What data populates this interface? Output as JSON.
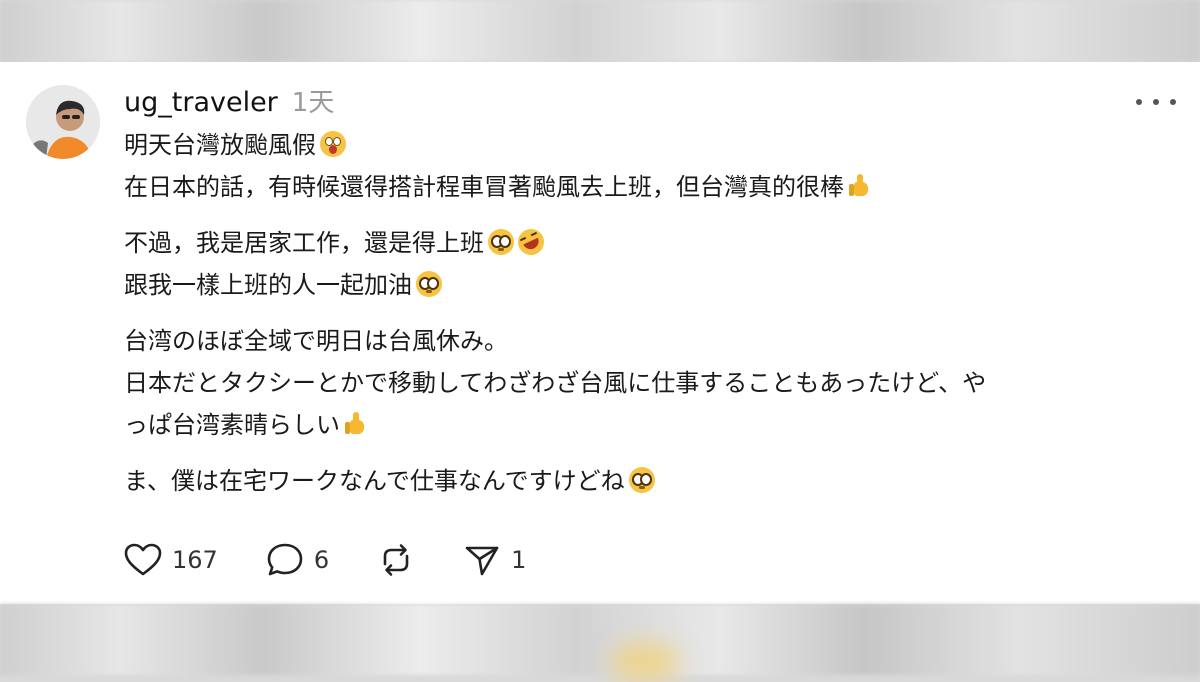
{
  "post": {
    "username": "ug_traveler",
    "time": "1天",
    "paragraphs": [
      [
        "明天台灣放颱風假",
        "在日本的話，有時候還得搭計程車冒著颱風去上班，但台灣真的很棒"
      ],
      [
        "不過，我是居家工作，還是得上班",
        "跟我一樣上班的人一起加油"
      ],
      [
        "台湾のほぼ全域で明日は台風休み。",
        "日本だとタクシーとかで移動してわざわざ台風に仕事することもあったけど、や",
        "っぱ台湾素晴らしい"
      ],
      [
        "ま、僕は在宅ワークなんで仕事なんですけどね"
      ]
    ]
  },
  "actions": {
    "likes": "167",
    "comments": "6",
    "shares": "1"
  },
  "icons": {
    "like": "heart-icon",
    "comment": "comment-bubble-icon",
    "repost": "repost-icon",
    "share": "send-icon",
    "more": "more-dots-icon"
  }
}
